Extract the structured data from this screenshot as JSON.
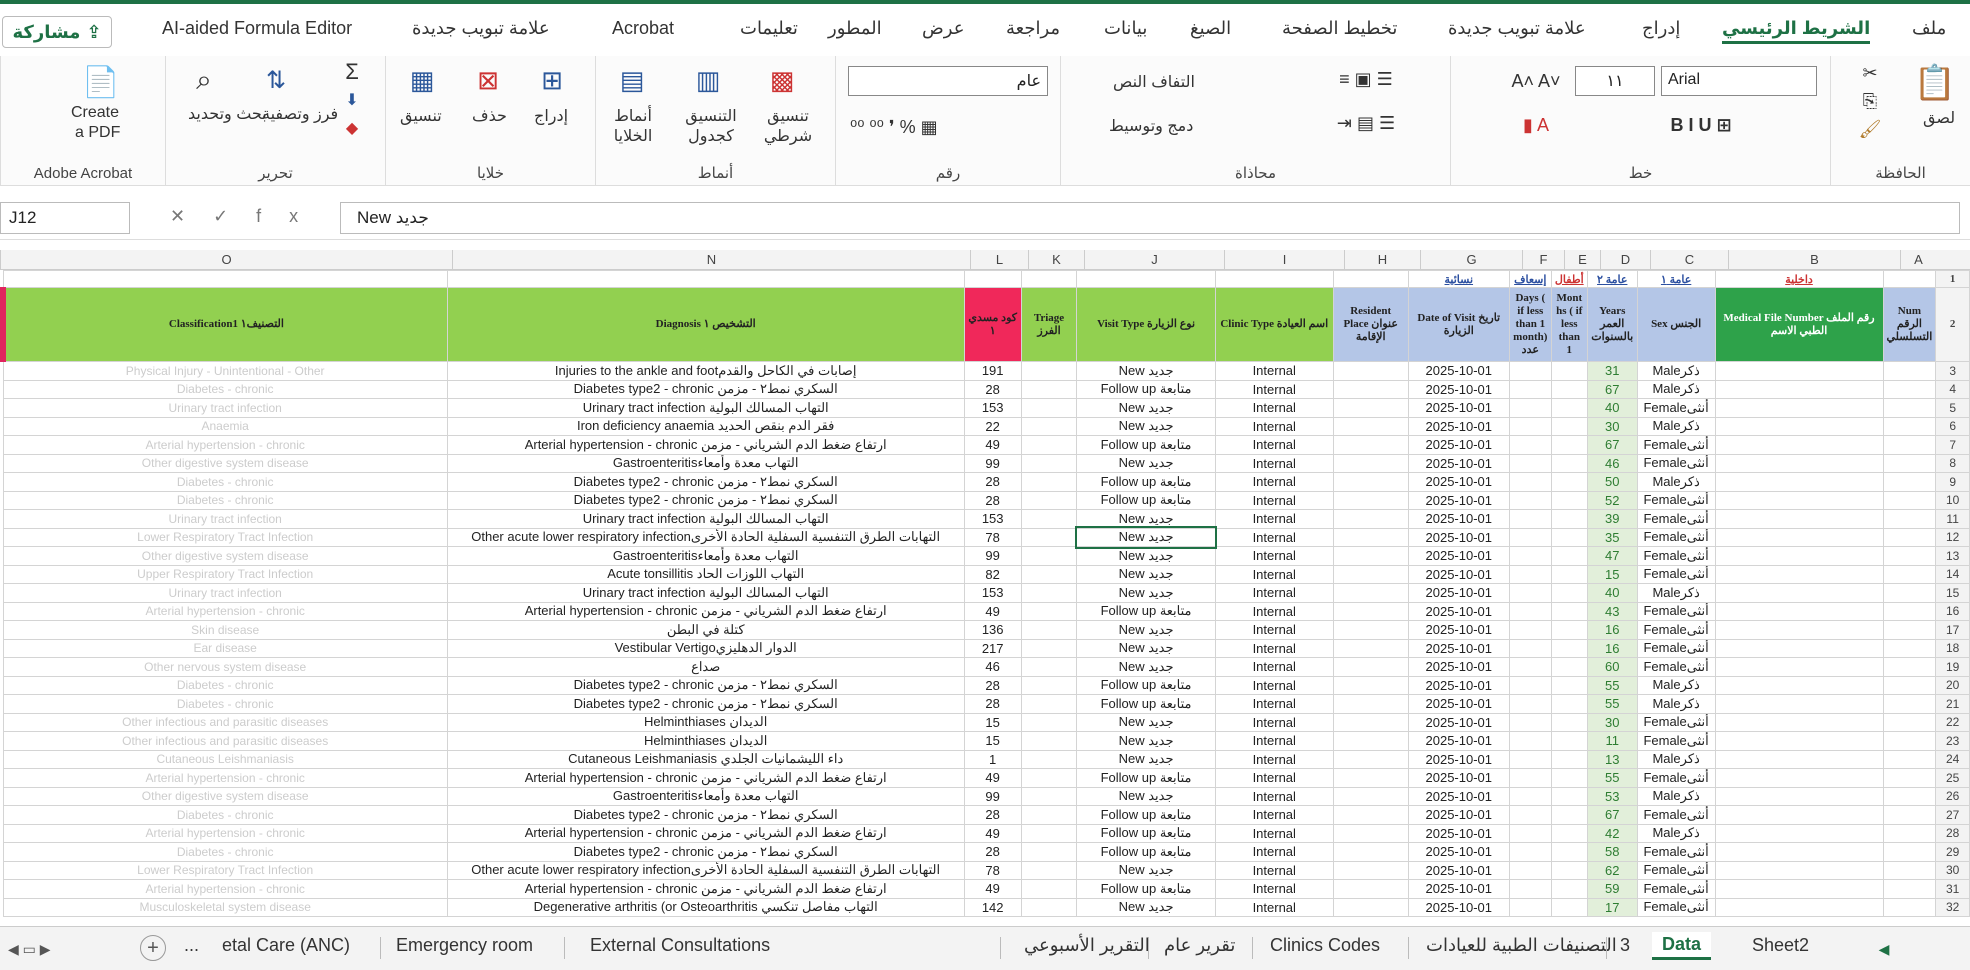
{
  "ribbon_tabs": [
    "ملف",
    "الشريط الرئيسي",
    "إدراج",
    "علامة تبويب جديدة",
    "تخطيط الصفحة",
    "الصيغ",
    "بيانات",
    "مراجعة",
    "عرض",
    "المطور",
    "تعليمات",
    "Acrobat",
    "علامة تبويب جديدة",
    "AI-aided Formula Editor"
  ],
  "share_label": "مشاركة",
  "groups": {
    "clipboard": "الحافظة",
    "font": "خط",
    "alignment": "محاذاة",
    "number": "رقم",
    "styles": "أنماط",
    "cells": "خلايا",
    "editing": "تحرير",
    "acrobat": "Adobe Acrobat"
  },
  "labels": {
    "paste": "لصق",
    "font_name": "Arial",
    "font_size": "١١",
    "wrap": "التفاف النص",
    "merge": "دمج وتوسيط",
    "num_format": "عام",
    "cond_format": "تنسيق شرطي",
    "format_table": "التنسيق كجدول",
    "cell_styles": "أنماط الخلايا",
    "insert": "إدراج",
    "delete": "حذف",
    "format": "تنسيق",
    "sort": "فرز وتصفية",
    "find": "بحث وتحديد",
    "create_pdf_1": "Create",
    "create_pdf_2": "a PDF"
  },
  "formula_bar": {
    "name_box": "J12",
    "formula": "New جديد",
    "fx": "fx"
  },
  "columns": [
    "A",
    "B",
    "C",
    "D",
    "E",
    "F",
    "G",
    "H",
    "I",
    "J",
    "K",
    "L",
    "N",
    "O"
  ],
  "row1": {
    "B": "داخلية",
    "C": "عامة ١",
    "D": "عامة ٢",
    "E": "أطفال",
    "F": "إسعاف",
    "G": "نسائية"
  },
  "headers": {
    "A": "Num الرقم التسلسلي",
    "B": "Medical File Number رقم الملف الطبي الاسم",
    "C": "Sex الجنس",
    "D": "Years العمر بالسنوات",
    "E": "Mont hs ( if less than 1",
    "F": "Days ( if less than 1 month) عدد",
    "G": "Date of Visit تاريخ الزيارة",
    "H": "Resident Place عنوان الإقامة",
    "I": "Clinic Type اسم العيادة",
    "J": "Visit Type نوع الزيارة",
    "K": "Triage الفرز",
    "L": "كود مسدي ١",
    "N": "Diagnosis التشخيص ١",
    "O": "Classification1 التصنيف١"
  },
  "rows": [
    {
      "n": "3",
      "sex": "Maleذكر",
      "age": "31",
      "date": "2025-10-01",
      "clinic": "Internal",
      "visit": "New جديد",
      "code": "191",
      "diag": "Injuries to the ankle and footإصابات في الكاحل والقدم",
      "cls": "Physical Injury - Unintentional - Other"
    },
    {
      "n": "4",
      "sex": "Maleذكر",
      "age": "67",
      "date": "2025-10-01",
      "clinic": "Internal",
      "visit": "Follow up متابعة",
      "code": "28",
      "diag": "Diabetes type2 - chronic السكري نمط٢ - مزمن",
      "cls": "Diabetes - chronic"
    },
    {
      "n": "5",
      "sex": "Femaleأنثى",
      "age": "40",
      "date": "2025-10-01",
      "clinic": "Internal",
      "visit": "New جديد",
      "code": "153",
      "diag": "Urinary tract infection التهاب المسالك البولية",
      "cls": "Urinary tract infection"
    },
    {
      "n": "6",
      "sex": "Maleذكر",
      "age": "30",
      "date": "2025-10-01",
      "clinic": "Internal",
      "visit": "New جديد",
      "code": "22",
      "diag": "Iron deficiency anaemia فقر الدم بنقص الحديد",
      "cls": "Anaemia"
    },
    {
      "n": "7",
      "sex": "Femaleأنثى",
      "age": "67",
      "date": "2025-10-01",
      "clinic": "Internal",
      "visit": "Follow up متابعة",
      "code": "49",
      "diag": "Arterial hypertension - chronic ارتفاع ضغط الدم الشرياني - مزمن",
      "cls": "Arterial hypertension - chronic"
    },
    {
      "n": "8",
      "sex": "Femaleأنثى",
      "age": "46",
      "date": "2025-10-01",
      "clinic": "Internal",
      "visit": "New جديد",
      "code": "99",
      "diag": "Gastroenteritisالتهاب معدة وأمعاء",
      "cls": "Other digestive system disease"
    },
    {
      "n": "9",
      "sex": "Maleذكر",
      "age": "50",
      "date": "2025-10-01",
      "clinic": "Internal",
      "visit": "Follow up متابعة",
      "code": "28",
      "diag": "Diabetes type2 - chronic السكري نمط٢ - مزمن",
      "cls": "Diabetes - chronic"
    },
    {
      "n": "10",
      "sex": "Femaleأنثى",
      "age": "52",
      "date": "2025-10-01",
      "clinic": "Internal",
      "visit": "Follow up متابعة",
      "code": "28",
      "diag": "Diabetes type2 - chronic السكري نمط٢ - مزمن",
      "cls": "Diabetes - chronic"
    },
    {
      "n": "11",
      "sex": "Femaleأنثى",
      "age": "39",
      "date": "2025-10-01",
      "clinic": "Internal",
      "visit": "New جديد",
      "code": "153",
      "diag": "Urinary tract infection التهاب المسالك البولية",
      "cls": "Urinary tract infection"
    },
    {
      "n": "12",
      "sex": "Femaleأنثى",
      "age": "35",
      "date": "2025-10-01",
      "clinic": "Internal",
      "visit": "New جديد",
      "code": "78",
      "diag": "Other acute lower respiratory infectionالتهابات الطرق التنفسية السفلية الحادة الأخرى",
      "cls": "Lower Respiratory Tract Infection"
    },
    {
      "n": "13",
      "sex": "Femaleأنثى",
      "age": "47",
      "date": "2025-10-01",
      "clinic": "Internal",
      "visit": "New جديد",
      "code": "99",
      "diag": "Gastroenteritisالتهاب معدة وأمعاء",
      "cls": "Other digestive system disease"
    },
    {
      "n": "14",
      "sex": "Femaleأنثى",
      "age": "15",
      "date": "2025-10-01",
      "clinic": "Internal",
      "visit": "New جديد",
      "code": "82",
      "diag": "Acute tonsillitis التهاب اللوزات الحاد",
      "cls": "Upper Respiratory Tract Infection"
    },
    {
      "n": "15",
      "sex": "Maleذكر",
      "age": "40",
      "date": "2025-10-01",
      "clinic": "Internal",
      "visit": "New جديد",
      "code": "153",
      "diag": "Urinary tract infection التهاب المسالك البولية",
      "cls": "Urinary tract infection"
    },
    {
      "n": "16",
      "sex": "Femaleأنثى",
      "age": "43",
      "date": "2025-10-01",
      "clinic": "Internal",
      "visit": "Follow up متابعة",
      "code": "49",
      "diag": "Arterial hypertension - chronic ارتفاع ضغط الدم الشرياني - مزمن",
      "cls": "Arterial hypertension - chronic"
    },
    {
      "n": "17",
      "sex": "Femaleأنثى",
      "age": "16",
      "date": "2025-10-01",
      "clinic": "Internal",
      "visit": "New جديد",
      "code": "136",
      "diag": "كتلة في البطن",
      "cls": "Skin disease"
    },
    {
      "n": "18",
      "sex": "Femaleأنثى",
      "age": "16",
      "date": "2025-10-01",
      "clinic": "Internal",
      "visit": "New جديد",
      "code": "217",
      "diag": "Vestibular Vertigoالدوار الدهليزي",
      "cls": "Ear disease"
    },
    {
      "n": "19",
      "sex": "Femaleأنثى",
      "age": "60",
      "date": "2025-10-01",
      "clinic": "Internal",
      "visit": "New جديد",
      "code": "46",
      "diag": "صداع",
      "cls": "Other nervous system disease"
    },
    {
      "n": "20",
      "sex": "Maleذكر",
      "age": "55",
      "date": "2025-10-01",
      "clinic": "Internal",
      "visit": "Follow up متابعة",
      "code": "28",
      "diag": "Diabetes type2 - chronic السكري نمط٢ - مزمن",
      "cls": "Diabetes - chronic"
    },
    {
      "n": "21",
      "sex": "Maleذكر",
      "age": "55",
      "date": "2025-10-01",
      "clinic": "Internal",
      "visit": "Follow up متابعة",
      "code": "28",
      "diag": "Diabetes type2 - chronic السكري نمط٢ - مزمن",
      "cls": "Diabetes - chronic"
    },
    {
      "n": "22",
      "sex": "Femaleأنثى",
      "age": "30",
      "date": "2025-10-01",
      "clinic": "Internal",
      "visit": "New جديد",
      "code": "15",
      "diag": "Helminthiases الديدان",
      "cls": "Other infectious and parasitic diseases"
    },
    {
      "n": "23",
      "sex": "Femaleأنثى",
      "age": "11",
      "date": "2025-10-01",
      "clinic": "Internal",
      "visit": "New جديد",
      "code": "15",
      "diag": "Helminthiases الديدان",
      "cls": "Other infectious and parasitic diseases"
    },
    {
      "n": "24",
      "sex": "Maleذكر",
      "age": "13",
      "date": "2025-10-01",
      "clinic": "Internal",
      "visit": "New جديد",
      "code": "1",
      "diag": "Cutaneous Leishmaniasis داء الليشمانيات الجلدي",
      "cls": "Cutaneous Leishmaniasis"
    },
    {
      "n": "25",
      "sex": "Femaleأنثى",
      "age": "55",
      "date": "2025-10-01",
      "clinic": "Internal",
      "visit": "Follow up متابعة",
      "code": "49",
      "diag": "Arterial hypertension - chronic ارتفاع ضغط الدم الشرياني - مزمن",
      "cls": "Arterial hypertension - chronic"
    },
    {
      "n": "26",
      "sex": "Maleذكر",
      "age": "53",
      "date": "2025-10-01",
      "clinic": "Internal",
      "visit": "New جديد",
      "code": "99",
      "diag": "Gastroenteritisالتهاب معدة وأمعاء",
      "cls": "Other digestive system disease"
    },
    {
      "n": "27",
      "sex": "Femaleأنثى",
      "age": "67",
      "date": "2025-10-01",
      "clinic": "Internal",
      "visit": "Follow up متابعة",
      "code": "28",
      "diag": "Diabetes type2 - chronic السكري نمط٢ - مزمن",
      "cls": "Diabetes - chronic"
    },
    {
      "n": "28",
      "sex": "Maleذكر",
      "age": "42",
      "date": "2025-10-01",
      "clinic": "Internal",
      "visit": "Follow up متابعة",
      "code": "49",
      "diag": "Arterial hypertension - chronic ارتفاع ضغط الدم الشرياني - مزمن",
      "cls": "Arterial hypertension - chronic"
    },
    {
      "n": "29",
      "sex": "Femaleأنثى",
      "age": "58",
      "date": "2025-10-01",
      "clinic": "Internal",
      "visit": "Follow up متابعة",
      "code": "28",
      "diag": "Diabetes type2 - chronic السكري نمط٢ - مزمن",
      "cls": "Diabetes - chronic"
    },
    {
      "n": "30",
      "sex": "Femaleأنثى",
      "age": "62",
      "date": "2025-10-01",
      "clinic": "Internal",
      "visit": "New جديد",
      "code": "78",
      "diag": "Other acute lower respiratory infectionالتهابات الطرق التنفسية السفلية الحادة الأخرى",
      "cls": "Lower Respiratory Tract Infection"
    },
    {
      "n": "31",
      "sex": "Femaleأنثى",
      "age": "59",
      "date": "2025-10-01",
      "clinic": "Internal",
      "visit": "Follow up متابعة",
      "code": "49",
      "diag": "Arterial hypertension - chronic ارتفاع ضغط الدم الشرياني - مزمن",
      "cls": "Arterial hypertension - chronic"
    },
    {
      "n": "32",
      "sex": "Femaleأنثى",
      "age": "17",
      "date": "2025-10-01",
      "clinic": "Internal",
      "visit": "New جديد",
      "code": "142",
      "diag": "Degenerative arthritis (or Osteoarthritis التهاب مفاصل تنكسي",
      "cls": "Musculoskeletal system disease"
    }
  ],
  "sheet_tabs": [
    "Sheet2",
    "Data",
    "3",
    "التصنيفات الطبية للعيادات",
    "Clinics Codes",
    "تقرير عام",
    "التقرير الأسبوعي",
    "External Consultations",
    "Emergency room",
    "etal Care (ANC)"
  ],
  "active_sheet": "Data",
  "ellipsis": "..."
}
